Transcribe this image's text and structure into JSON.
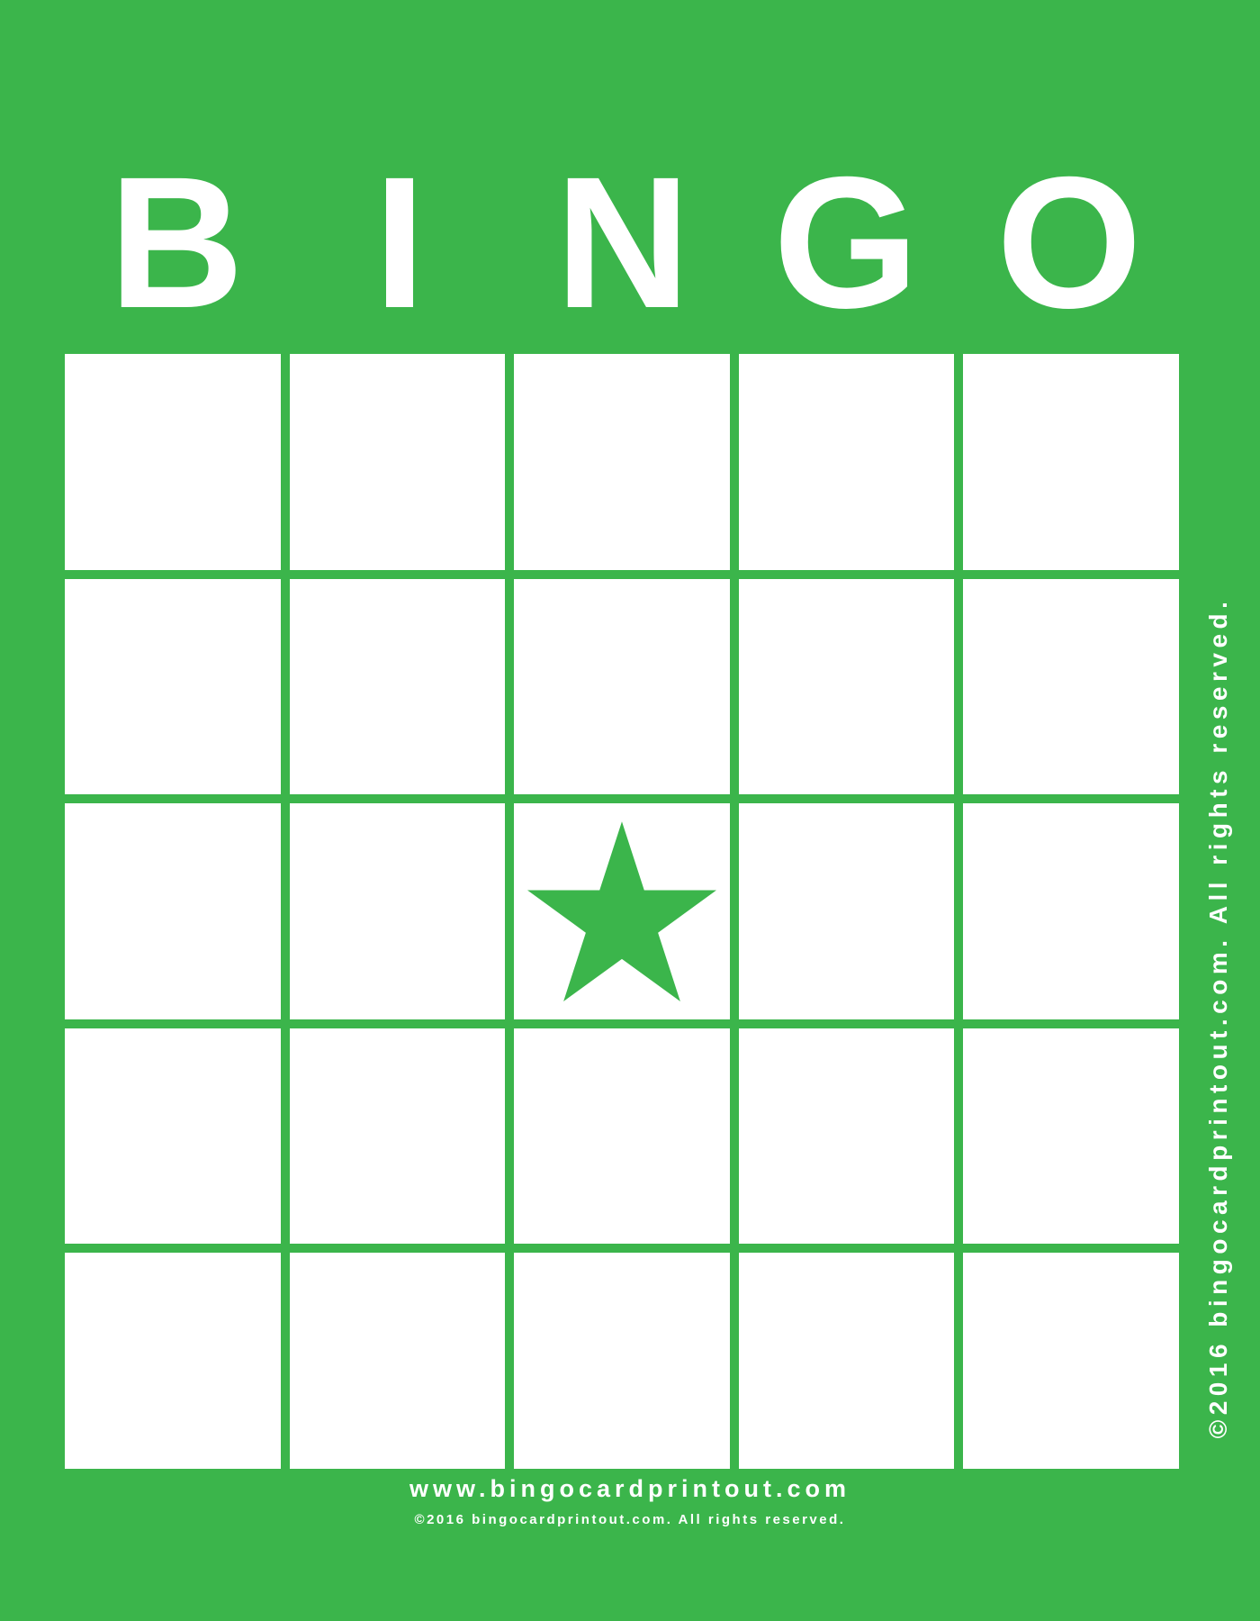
{
  "colors": {
    "background": "#3bb54b",
    "cell": "#ffffff",
    "text": "#ffffff",
    "star": "#3bb54b"
  },
  "title": {
    "letters": [
      "B",
      "I",
      "N",
      "G",
      "O"
    ]
  },
  "grid": {
    "rows": 5,
    "columns": 5,
    "free_space": {
      "row": 3,
      "column": 3,
      "icon": "star-icon"
    }
  },
  "footer": {
    "url": "www.bingocardprintout.com",
    "copyright": "©2016 bingocardprintout.com. All rights reserved."
  },
  "side_text": "©2016 bingocardprintout.com. All rights reserved."
}
